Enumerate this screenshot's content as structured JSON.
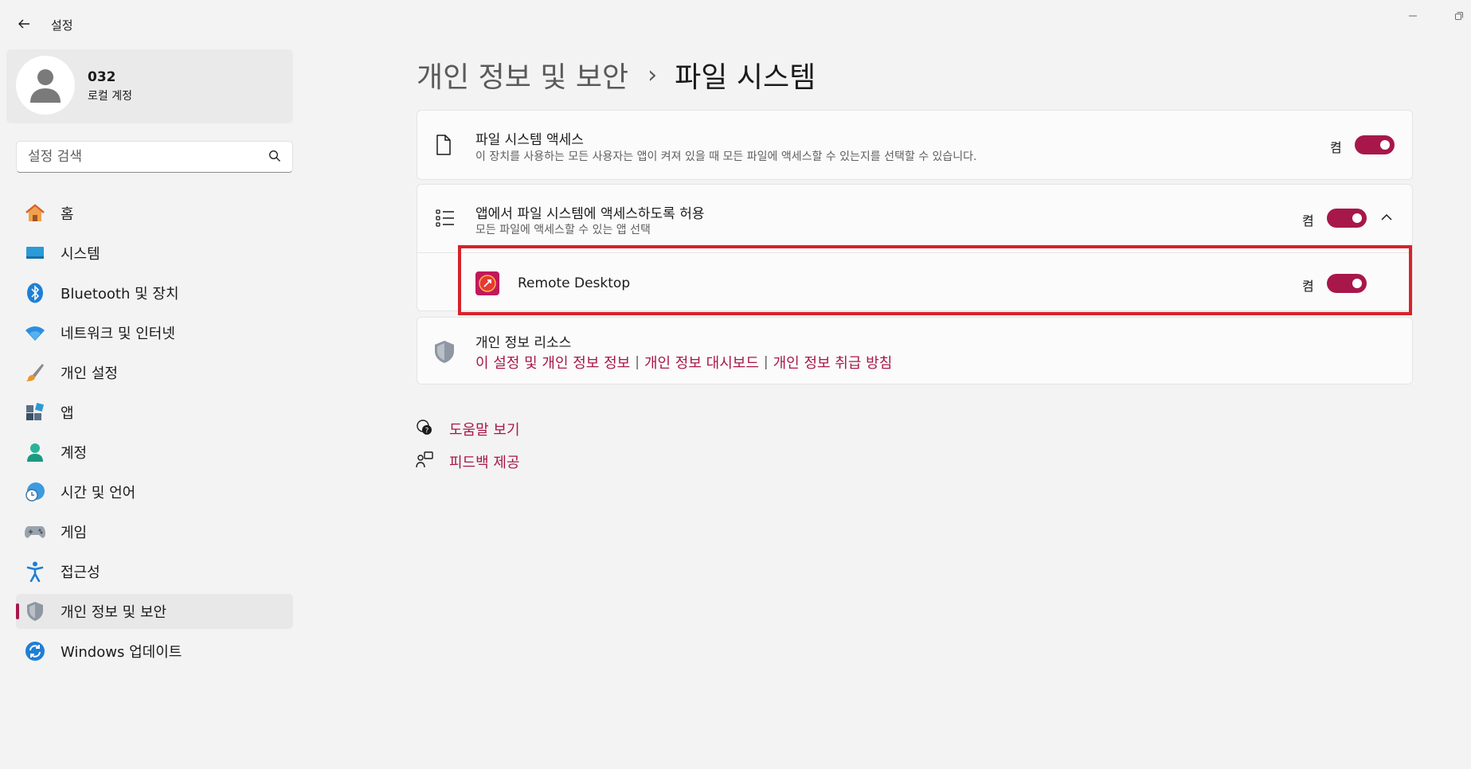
{
  "window": {
    "title": "설정",
    "controls": [
      "minimize-icon",
      "restore-icon"
    ]
  },
  "profile": {
    "name": "032",
    "account_type": "로컬 계정"
  },
  "search": {
    "placeholder": "설정 검색"
  },
  "sidebar": {
    "items": [
      {
        "label": "홈",
        "icon": "home-icon"
      },
      {
        "label": "시스템",
        "icon": "system-icon"
      },
      {
        "label": "Bluetooth 및 장치",
        "icon": "bluetooth-icon"
      },
      {
        "label": "네트워크 및 인터넷",
        "icon": "wifi-icon"
      },
      {
        "label": "개인 설정",
        "icon": "brush-icon"
      },
      {
        "label": "앱",
        "icon": "apps-icon"
      },
      {
        "label": "계정",
        "icon": "account-icon"
      },
      {
        "label": "시간 및 언어",
        "icon": "time-language-icon"
      },
      {
        "label": "게임",
        "icon": "gamepad-icon"
      },
      {
        "label": "접근성",
        "icon": "accessibility-icon"
      },
      {
        "label": "개인 정보 및 보안",
        "icon": "shield-icon",
        "active": true
      },
      {
        "label": "Windows 업데이트",
        "icon": "update-icon"
      }
    ]
  },
  "breadcrumb": {
    "parent": "개인 정보 및 보안",
    "separator": "›",
    "current": "파일 시스템"
  },
  "settings": {
    "fs_access": {
      "title": "파일 시스템 액세스",
      "description": "이 장치를 사용하는 모든 사용자는 앱이 켜져 있을 때 모든 파일에 액세스할 수 있는지를 선택할 수 있습니다.",
      "state": "켬",
      "on": true
    },
    "app_access": {
      "title": "앱에서 파일 시스템에 액세스하도록 허용",
      "description": "모든 파일에 액세스할 수 있는 앱 선택",
      "state": "켬",
      "on": true,
      "expanded": true
    },
    "apps": [
      {
        "name": "Remote Desktop",
        "state": "켬",
        "on": true,
        "icon": "remote-desktop-icon"
      }
    ],
    "privacy_resources": {
      "title": "개인 정보 리소스",
      "links": [
        "이 설정 및 개인 정보 정보",
        "개인 정보 대시보드",
        "개인 정보 취급 방침"
      ]
    }
  },
  "help": {
    "get_help": "도움말 보기",
    "feedback": "피드백 제공"
  },
  "colors": {
    "accent": "#a8174a",
    "highlight_box": "#d6232c",
    "background": "#f3f3f3",
    "card": "#fbfbfb"
  }
}
